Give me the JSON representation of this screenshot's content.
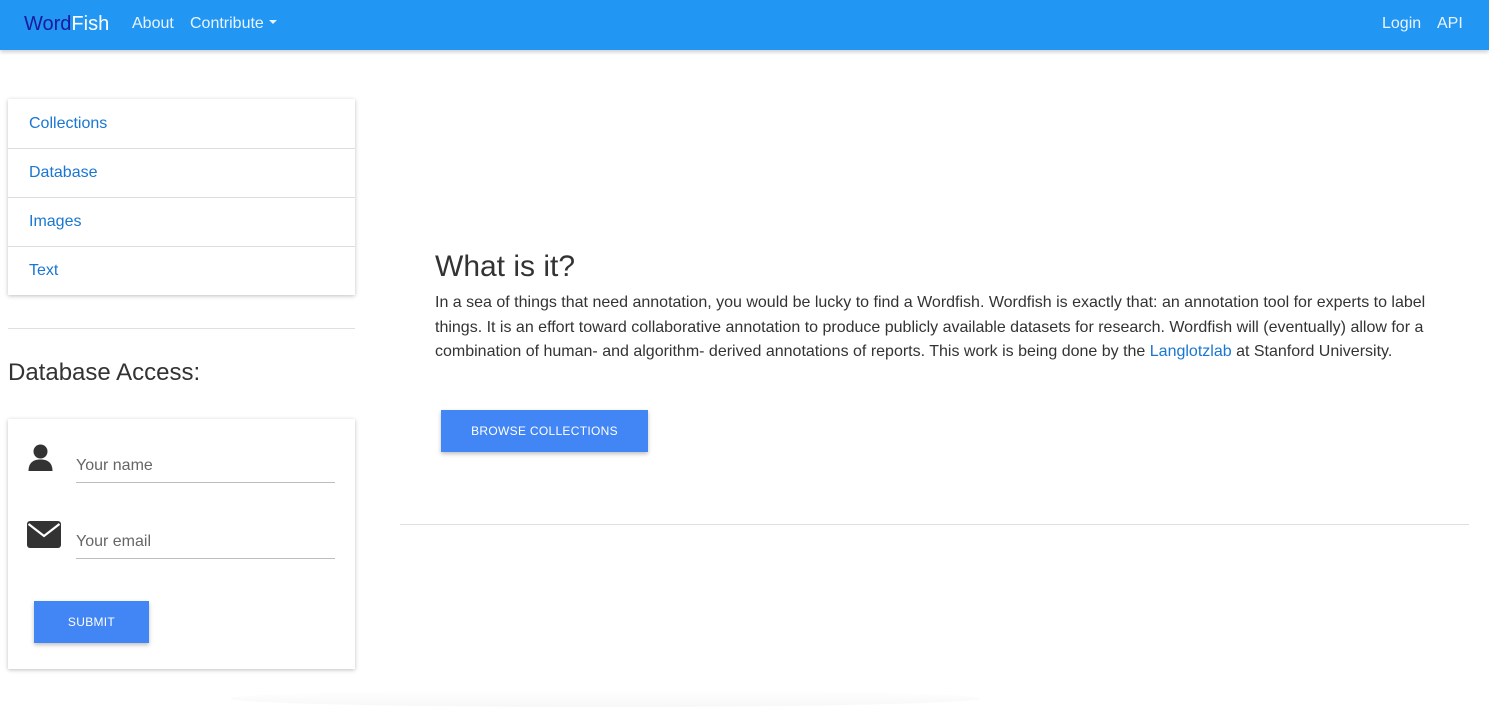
{
  "navbar": {
    "brand_part1": "Word",
    "brand_part2": "Fish",
    "about": "About",
    "contribute": "Contribute",
    "login": "Login",
    "api": "API",
    "color": "#2196f3"
  },
  "sidebar": {
    "items": [
      {
        "label": "Collections"
      },
      {
        "label": "Database"
      },
      {
        "label": "Images"
      },
      {
        "label": "Text"
      }
    ]
  },
  "database_access": {
    "title": "Database Access:",
    "name_placeholder": "Your name",
    "email_placeholder": "Your email",
    "submit_label": "SUBMIT",
    "icons": [
      "user-icon",
      "envelope-icon"
    ]
  },
  "main": {
    "title": "What is it?",
    "paragraph_before_link": "In a sea of things that need annotation, you would be lucky to find a Wordfish. Wordfish is exactly that: an annotation tool for experts to label things. It is an effort toward collaborative annotation to produce publicly available datasets for research. Wordfish will (eventually) allow for a combination of human- and algorithm- derived annotations of reports. This work is being done by the ",
    "link_text": "Langlotzlab",
    "paragraph_after_link": " at Stanford University.",
    "browse_label": "BROWSE COLLECTIONS"
  },
  "colors": {
    "accent": "#4285f4",
    "link": "#1976d2"
  }
}
